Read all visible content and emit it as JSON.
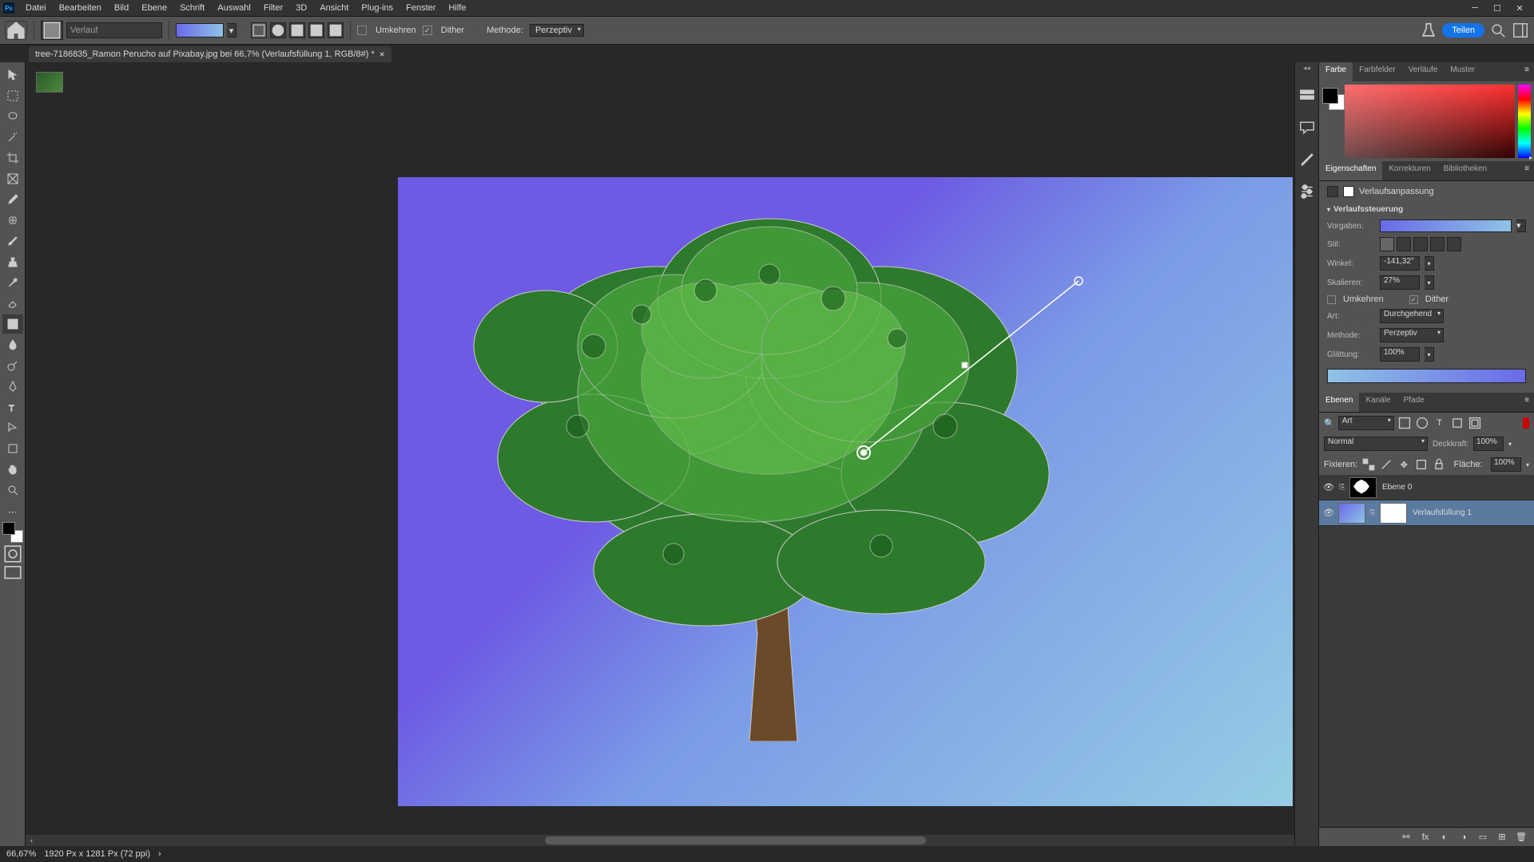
{
  "menu": {
    "items": [
      "Datei",
      "Bearbeiten",
      "Bild",
      "Ebene",
      "Schrift",
      "Auswahl",
      "Filter",
      "3D",
      "Ansicht",
      "Plug-ins",
      "Fenster",
      "Hilfe"
    ]
  },
  "optionsbar": {
    "preset_placeholder": "Verlauf",
    "reverse_label": "Umkehren",
    "reverse_checked": false,
    "dither_label": "Dither",
    "dither_checked": true,
    "method_label": "Methode:",
    "method_value": "Perzeptiv",
    "share_label": "Teilen"
  },
  "document": {
    "tab_title": "tree-7186835_Ramon Perucho auf Pixabay.jpg bei 66,7% (Verlaufsfüllung 1, RGB/8#) *"
  },
  "panels": {
    "color": {
      "tabs": [
        "Farbe",
        "Farbfelder",
        "Verläufe",
        "Muster"
      ]
    },
    "properties": {
      "tabs": [
        "Eigenschaften",
        "Korrekturen",
        "Bibliotheken"
      ],
      "title": "Verlaufsanpassung",
      "section_title": "Verlaufssteuerung",
      "preset_label": "Vorgaben:",
      "style_label": "Stil:",
      "angle_label": "Winkel:",
      "angle_value": "-141,32°",
      "scale_label": "Skalieren:",
      "scale_value": "27%",
      "reverse_label": "Umkehren",
      "reverse_checked": false,
      "dither_label": "Dither",
      "dither_checked": true,
      "art_label": "Art:",
      "art_value": "Durchgehend",
      "method_label": "Methode:",
      "method_value": "Perzeptiv",
      "smooth_label": "Glättung:",
      "smooth_value": "100%"
    },
    "layers": {
      "tabs": [
        "Ebenen",
        "Kanäle",
        "Pfade"
      ],
      "filter_label": "Art",
      "blend_mode": "Normal",
      "opacity_label": "Deckkraft:",
      "opacity_value": "100%",
      "lock_label": "Fixieren:",
      "fill_label": "Fläche:",
      "fill_value": "100%",
      "items": [
        {
          "name": "Ebene 0"
        },
        {
          "name": "Verlaufsfüllung 1"
        }
      ]
    }
  },
  "statusbar": {
    "zoom": "66,67%",
    "doc_info": "1920 Px x 1281 Px (72 ppi)"
  }
}
